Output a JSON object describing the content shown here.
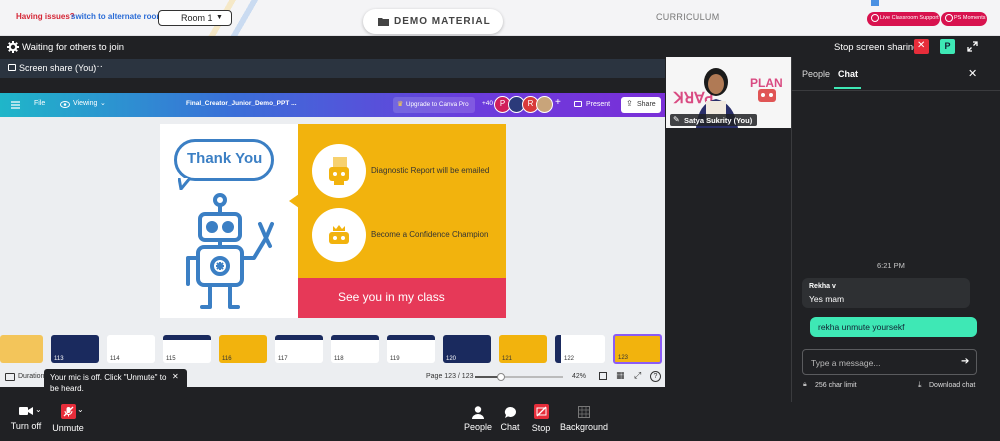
{
  "top": {
    "issue_label": "Having issues?",
    "switch_link": "switch to alternate room",
    "room_select": "Room 1",
    "demo_tab": "DEMO MATERIAL",
    "curriculum_tab": "CURRICULUM",
    "live_support": "Live Classroom Support",
    "ps_moments": "PS Moments"
  },
  "header": {
    "waiting": "Waiting for others to join",
    "stop_sharing": "Stop screen sharing",
    "avatar_letter": "P"
  },
  "share_tab": {
    "label": "Screen share (You)",
    "more": "···"
  },
  "canva": {
    "file": "File",
    "viewing": "Viewing",
    "doc_title": "Final_Creator_Junior_Demo_PPT ...",
    "upgrade": "Upgrade to Canva Pro",
    "plus_count": "+40",
    "avatars": [
      "P",
      "R"
    ],
    "present": "Present",
    "share": "Share"
  },
  "slide": {
    "thank_you": "Thank You",
    "item1": "Diagnostic Report will be emailed",
    "item2": "Become a Confidence Champion",
    "see_you": "See you in my class"
  },
  "thumbs": [
    "",
    "113",
    "114",
    "115",
    "116",
    "117",
    "118",
    "119",
    "120",
    "121",
    "122",
    "123"
  ],
  "bottom_canva": {
    "duration": "Duration",
    "page": "Page 123 / 123",
    "zoom": "42%",
    "zoom_fraction": 0.3,
    "help": "?"
  },
  "tooltip": {
    "text": "Your mic is off. Click \"Unmute\" to be heard.",
    "close": "✕"
  },
  "video": {
    "name": "Satya Sukrity (You)",
    "brand": "PLANET PARK"
  },
  "panel": {
    "tab_people": "People",
    "tab_chat": "Chat",
    "time": "6:21 PM",
    "messages": [
      {
        "sender": "Rekha v",
        "text": "Yes mam",
        "own": false
      },
      {
        "sender": "",
        "text": "rekha unmute yoursekf",
        "own": true
      }
    ],
    "input_placeholder": "Type a message...",
    "char_limit": "256 char limit",
    "download": "Download chat"
  },
  "toolbar": {
    "turn_off": "Turn off",
    "unmute": "Unmute",
    "people": "People",
    "chat": "Chat",
    "stop": "Stop",
    "background": "Background"
  },
  "colors": {
    "accent_green": "#3ee8b5",
    "danger_red": "#e0115f",
    "slide_yellow": "#f2b30d",
    "slide_pink": "#e63958",
    "robot_blue": "#3b7fc4",
    "canva_purple": "#7b3ff2"
  },
  "icons": [
    "gear-icon",
    "close-icon",
    "fullscreen-icon",
    "hamburger-icon",
    "eye-icon",
    "chevron-down-icon",
    "crown-icon",
    "present-icon",
    "share-icon",
    "send-icon",
    "lock-icon",
    "download-icon",
    "camera-icon",
    "mic-off-icon",
    "person-icon",
    "chat-icon",
    "stop-share-icon",
    "background-icon",
    "monitor-icon",
    "folder-icon"
  ]
}
